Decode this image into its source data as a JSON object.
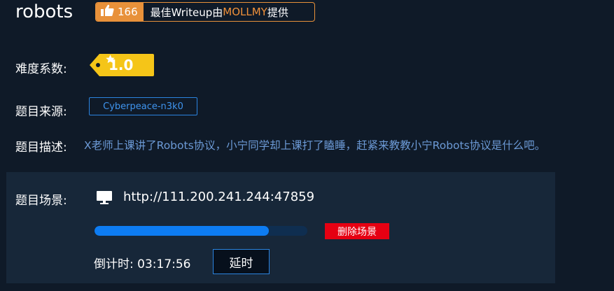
{
  "challenge": {
    "title": "robots",
    "likes": "166",
    "writeup_prefix": "最佳Writeup由",
    "writeup_author": "MOLLMY",
    "writeup_suffix": "提供"
  },
  "difficulty": {
    "label": "难度系数:",
    "value": "1.0",
    "color": "#f5c518"
  },
  "source": {
    "label": "题目来源:",
    "value": "Cyberpeace-n3k0"
  },
  "description": {
    "label": "题目描述:",
    "text": "X老师上课讲了Robots协议，小宁同学却上课打了瞌睡，赶紧来教教小宁Robots协议是什么吧。"
  },
  "scene": {
    "label": "题目场景:",
    "url": "http://111.200.241.244:47859",
    "progress_fraction": 0.82,
    "delete_label": "删除场景",
    "countdown_label": "倒计时:",
    "countdown_value": "03:17:56",
    "extend_label": "延时"
  },
  "colors": {
    "background": "#0f1a28",
    "panel": "#172739",
    "accent_orange": "#e8913a",
    "accent_blue": "#0d7cf2",
    "danger_red": "#e60012",
    "link_blue": "#6c9ad6"
  },
  "icons": {
    "like": "thumbs-up-icon",
    "difficulty": "star-icon",
    "scene": "monitor-icon"
  }
}
